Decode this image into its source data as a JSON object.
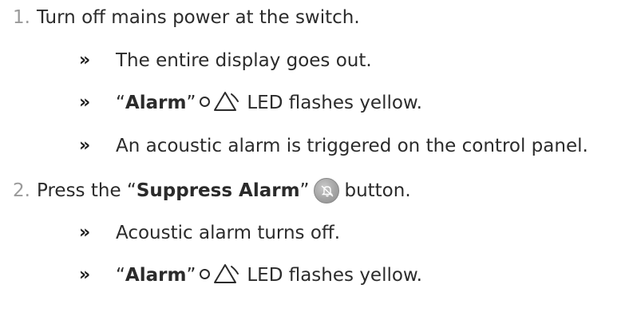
{
  "steps": [
    {
      "number": "1.",
      "text": "Turn off mains power at the switch.",
      "results": [
        {
          "text": "The entire display goes out."
        },
        {
          "quote_open": "“",
          "label": "Alarm",
          "quote_close": "”",
          "suffix": " LED flashes yellow."
        },
        {
          "text": "An acoustic alarm is triggered on the control panel."
        }
      ]
    },
    {
      "number": "2.",
      "prefix": "Press the “",
      "label": "Suppress Alarm",
      "quote_close": "”",
      "suffix": " button.",
      "results": [
        {
          "text": "Acoustic alarm turns off."
        },
        {
          "quote_open": "“",
          "label": "Alarm",
          "quote_close": "”",
          "suffix": " LED flashes yellow."
        }
      ]
    }
  ],
  "bullet_glyph": "»"
}
